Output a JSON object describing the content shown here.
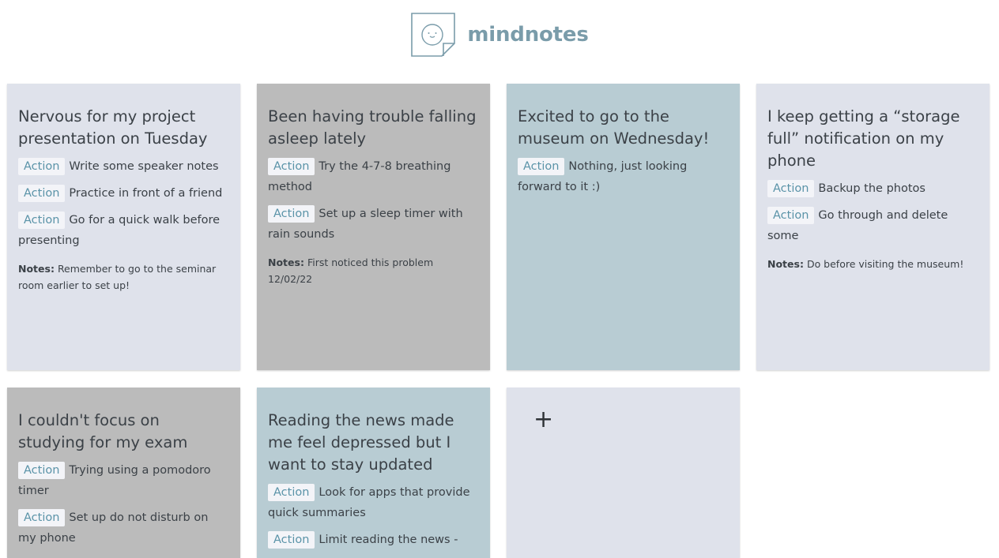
{
  "brand": {
    "name": "mindnotes",
    "logo_icon": "smiley-note-icon",
    "color": "#7a9caa"
  },
  "action_tag_label": "Action",
  "notes_label": "Notes:",
  "cards": [
    {
      "title": "Nervous for my project presentation on Tuesday",
      "actions": [
        "Write some speaker notes",
        "Practice in front of a friend",
        "Go for a quick walk before presenting"
      ],
      "notes": "Remember to go to the seminar room earlier to set up!"
    },
    {
      "title": "Been having trouble falling asleep lately",
      "actions": [
        "Try the 4-7-8 breathing method",
        "Set up a sleep timer with rain sounds"
      ],
      "notes": "First noticed this problem 12/02/22"
    },
    {
      "title": "Excited to go to the museum on Wednesday!",
      "actions": [
        "Nothing, just looking forward to it :)"
      ]
    },
    {
      "title": "I keep getting a “storage full” notification on my phone",
      "actions": [
        "Backup the photos",
        "Go through and delete some"
      ],
      "notes": "Do before visiting the museum!"
    },
    {
      "title": "I couldn't focus on studying for my exam",
      "actions": [
        "Trying using a pomodoro timer",
        "Set up do not disturb on my phone"
      ]
    },
    {
      "title": "Reading the news made me feel depressed but I want to stay updated",
      "actions": [
        "Look for apps that provide quick summaries",
        "Limit reading the news -"
      ]
    }
  ],
  "add_card": {
    "label": "+",
    "icon": "plus-icon"
  },
  "colors": {
    "light": "#dfe2eb",
    "grey": "#bbbbbb",
    "blue": "#b8ccd3",
    "action_text": "#5a93a8"
  }
}
